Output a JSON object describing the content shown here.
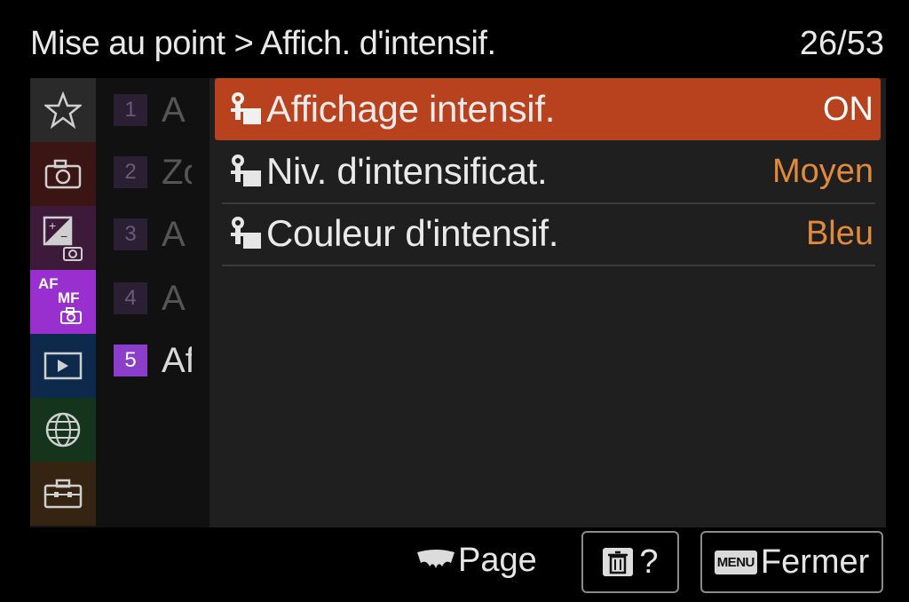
{
  "header": {
    "breadcrumb": "Mise au point > Affich. d'intensif.",
    "page_indicator": "26/53"
  },
  "categories": [
    {
      "name": "star-icon",
      "color": "#2a2a2a"
    },
    {
      "name": "camera-icon",
      "color": "#3b1414"
    },
    {
      "name": "exposure-icon",
      "color": "#3e1a3a"
    },
    {
      "name": "af-mf-icon",
      "color": "#9a2fd0",
      "text_af": "AF",
      "text_mf": "MF",
      "active": true
    },
    {
      "name": "playback-icon",
      "color": "#0d2a4d"
    },
    {
      "name": "globe-icon",
      "color": "#14351c"
    },
    {
      "name": "toolbox-icon",
      "color": "#352412"
    }
  ],
  "subpages": [
    {
      "num": "1",
      "letter": "A"
    },
    {
      "num": "2",
      "letter": "Zo"
    },
    {
      "num": "3",
      "letter": "A"
    },
    {
      "num": "4",
      "letter": "A"
    },
    {
      "num": "5",
      "letter": "Af",
      "active": true
    }
  ],
  "items": [
    {
      "icon": "focus-peaking-icon",
      "label": "Affichage intensif.",
      "value": "ON",
      "selected": true
    },
    {
      "icon": "focus-peaking-icon",
      "label": "Niv. d'intensificat.",
      "value": "Moyen"
    },
    {
      "icon": "focus-peaking-icon",
      "label": "Couleur d'intensif.",
      "value": "Bleu"
    }
  ],
  "footer": {
    "page_label": "Page",
    "help_label": "?",
    "menu_badge": "MENU",
    "close_label": "Fermer"
  },
  "colors": {
    "selected_row": "#b8421e",
    "value_text": "#e08a3a",
    "active_tab": "#9a2fd0"
  }
}
